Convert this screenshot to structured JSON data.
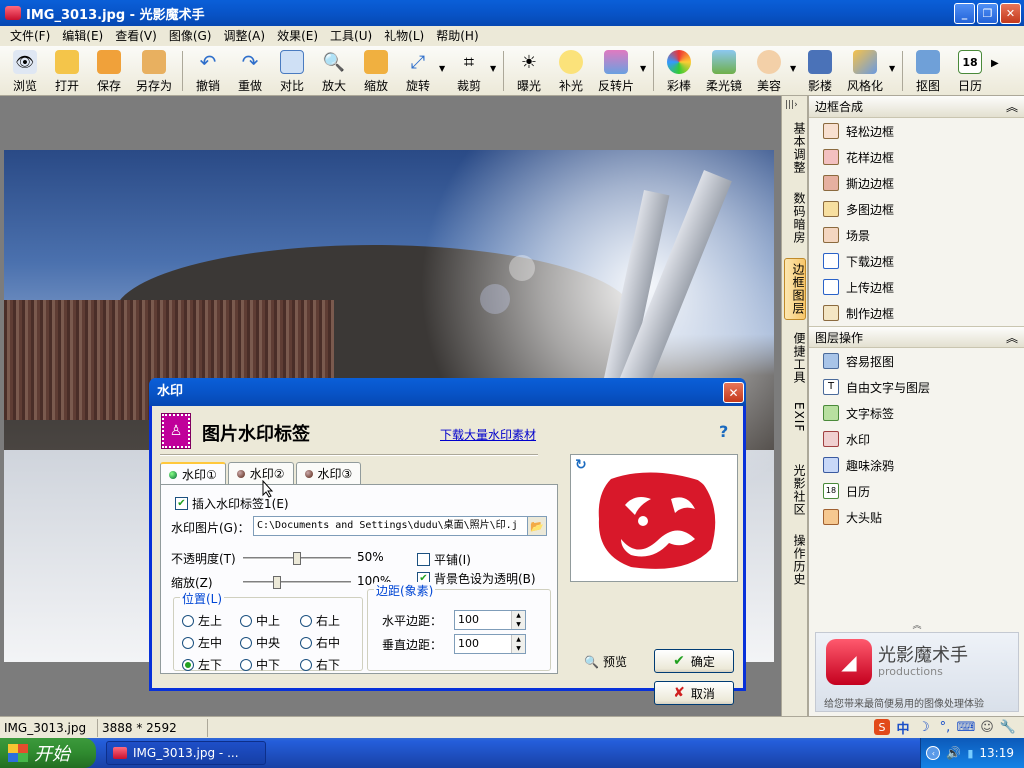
{
  "window": {
    "title": "IMG_3013.jpg - 光影魔术手"
  },
  "menu": [
    "文件(F)",
    "编辑(E)",
    "查看(V)",
    "图像(G)",
    "调整(A)",
    "效果(E)",
    "工具(U)",
    "礼物(L)",
    "帮助(H)"
  ],
  "toolbar": {
    "browse": "浏览",
    "open": "打开",
    "save": "保存",
    "save_as": "另存为",
    "undo": "撤销",
    "redo": "重做",
    "compare": "对比",
    "zoom_in": "放大",
    "shrink": "缩放",
    "rotate": "旋转",
    "crop": "裁剪",
    "exposure": "曝光",
    "fill_light": "补光",
    "negative": "反转片",
    "color_stick": "彩棒",
    "soft_light": "柔光镜",
    "beauty": "美容",
    "shadow": "影楼",
    "stylize": "风格化",
    "cutout": "抠图",
    "calendar": "日历"
  },
  "vtabs": [
    "基本调整",
    "数码暗房",
    "边框图层",
    "便捷工具",
    "EXIF",
    "光影社区",
    "操作历史"
  ],
  "panel": {
    "border_section": "边框合成",
    "border_items": [
      "轻松边框",
      "花样边框",
      "撕边边框",
      "多图边框",
      "场景",
      "下载边框",
      "上传边框",
      "制作边框"
    ],
    "layer_section": "图层操作",
    "layer_items": [
      "容易抠图",
      "自由文字与图层",
      "文字标签",
      "水印",
      "趣味涂鸦",
      "日历",
      "大头贴"
    ],
    "banner_title": "光影魔术手",
    "banner_sub": "productions",
    "banner_tagline": "给您带来最简便易用的图像处理体验"
  },
  "status": {
    "filename": "IMG_3013.jpg",
    "dimensions": "3888 * 2592"
  },
  "taskbar": {
    "start": "开始",
    "task": "IMG_3013.jpg - ...",
    "clock": "13:19"
  },
  "dialog": {
    "title": "水印",
    "heading": "图片水印标签",
    "download_link": "下载大量水印素材",
    "help": "?",
    "tabs": [
      "水印①",
      "水印②",
      "水印③"
    ],
    "insert_label": "插入水印标签1(E)",
    "insert_checked": true,
    "image_label": "水印图片(G)：",
    "image_path": "C:\\Documents and Settings\\dudu\\桌面\\照片\\印.j",
    "opacity_label": "不透明度(T)",
    "opacity_value": "50%",
    "opacity": 0.5,
    "scale_label": "缩放(Z)",
    "scale_value": "100%",
    "scale": 0.3,
    "tile_label": "平铺(I)",
    "tile_checked": false,
    "transparent_bg_label": "背景色设为透明(B)",
    "transparent_bg_checked": true,
    "position_title": "位置(L)",
    "positions": [
      "左上",
      "中上",
      "右上",
      "左中",
      "中央",
      "右中",
      "左下",
      "中下",
      "右下"
    ],
    "selected_position": "左下",
    "margin_title": "边距(象素)",
    "h_margin_label": "水平边距：",
    "h_margin": "100",
    "v_margin_label": "垂直边距：",
    "v_margin": "100",
    "preview": "预览",
    "ok": "确定",
    "cancel": "取消"
  }
}
